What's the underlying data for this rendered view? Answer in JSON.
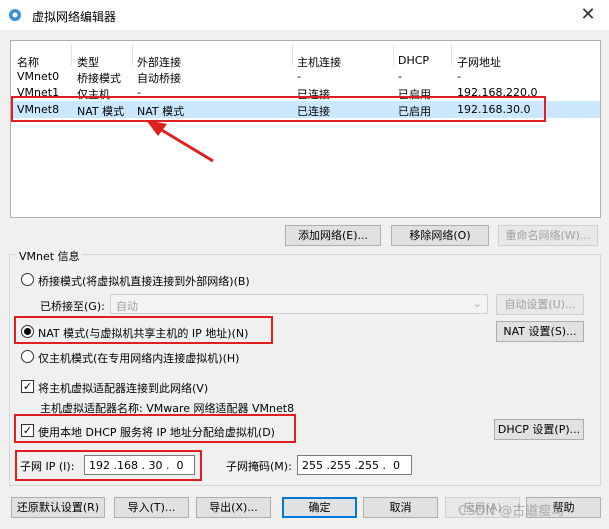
{
  "window": {
    "title": "虚拟网络编辑器",
    "close_symbol": "✕"
  },
  "table": {
    "headers": [
      "名称",
      "类型",
      "外部连接",
      "主机连接",
      "DHCP",
      "子网地址"
    ],
    "rows": [
      [
        "VMnet0",
        "桥接模式",
        "自动桥接",
        "-",
        "-",
        "-"
      ],
      [
        "VMnet1",
        "仅主机...",
        "-",
        "已连接",
        "已启用",
        "192.168.220.0"
      ],
      [
        "VMnet8",
        "NAT 模式",
        "NAT 模式",
        "已连接",
        "已启用",
        "192.168.30.0"
      ]
    ],
    "selected_row": 2
  },
  "list_buttons": {
    "add": "添加网络(E)...",
    "remove": "移除网络(O)",
    "rename": "重命名网络(W)..."
  },
  "vmnet_info": {
    "legend": "VMnet 信息",
    "bridge_mode": "桥接模式(将虚拟机直接连接到外部网络)(B)",
    "bridged_to_label": "已桥接至(G):",
    "bridged_to_value": "自动",
    "auto_settings": "自动设置(U)...",
    "nat_mode": "NAT 模式(与虚拟机共享主机的 IP 地址)(N)",
    "nat_settings": "NAT 设置(S)...",
    "host_only": "仅主机模式(在专用网络内连接虚拟机)(H)",
    "connect_adapter": "将主机虚拟适配器连接到此网络(V)",
    "adapter_name": "主机虚拟适配器名称: VMware 网络适配器 VMnet8",
    "use_dhcp": "使用本地 DHCP 服务将 IP 地址分配给虚拟机(D)",
    "dhcp_settings": "DHCP 设置(P)...",
    "subnet_ip_label": "子网 IP (I):",
    "subnet_ip_value": "192 .168 . 30 .  0",
    "subnet_mask_label": "子网掩码(M):",
    "subnet_mask_value": "255 .255 .255 .  0",
    "checkmark": "✓"
  },
  "footer_buttons": {
    "restore": "还原默认设置(R)",
    "import": "导入(T)...",
    "export": "导出(X)...",
    "ok": "确定",
    "cancel": "取消",
    "apply": "应用(A)",
    "help": "帮助"
  },
  "watermark": "CSDN @古道瘦马",
  "colors": {
    "annotation": "#e02020",
    "selection": "#cce8ff",
    "focus": "#0078d7"
  }
}
